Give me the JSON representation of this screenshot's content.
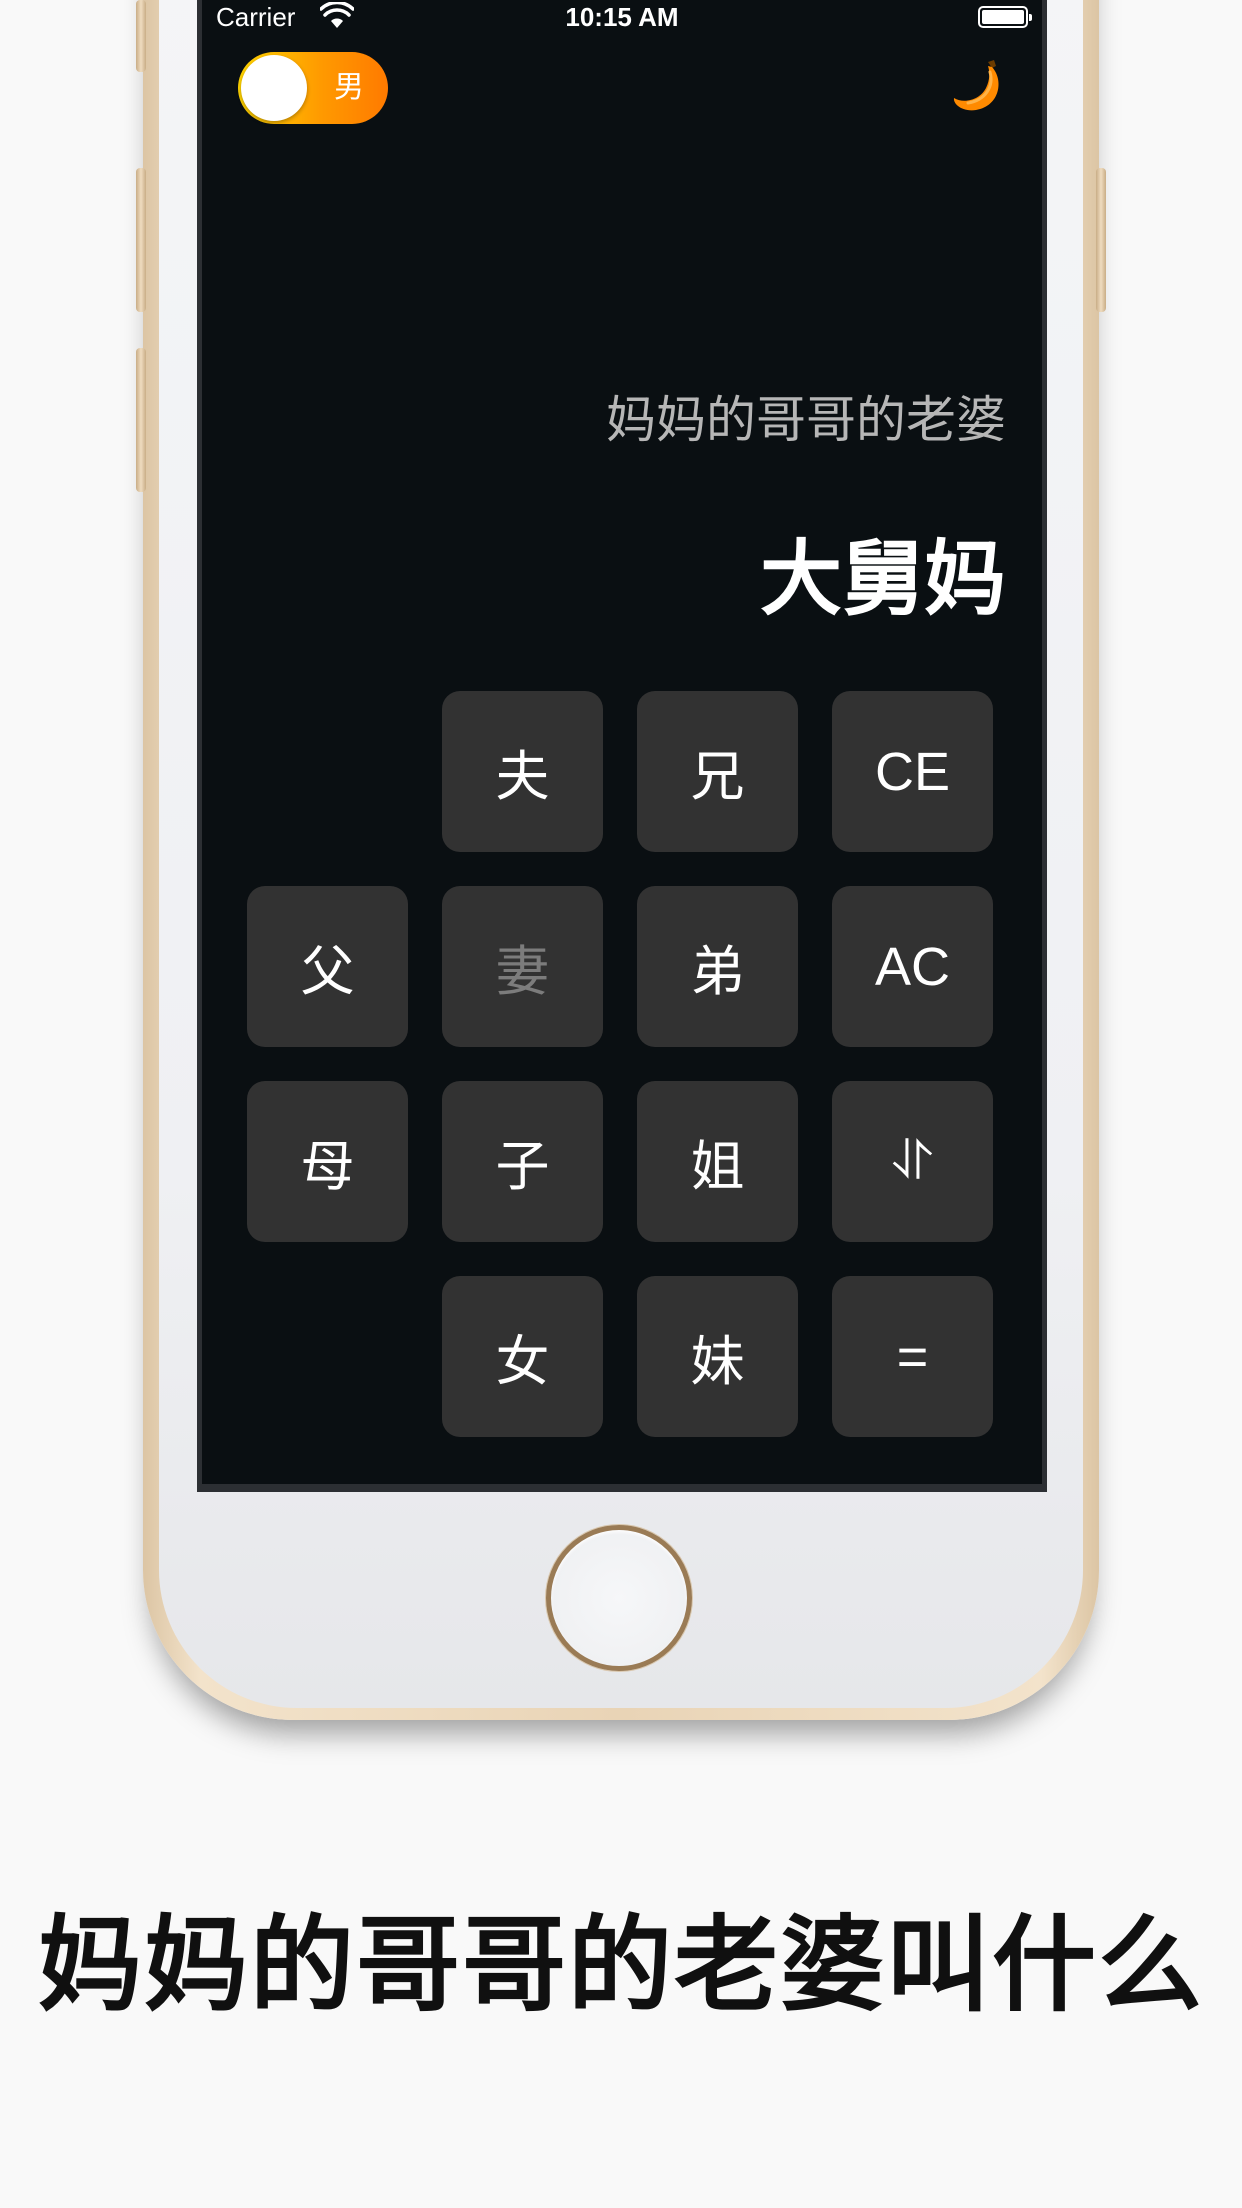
{
  "status_bar": {
    "carrier": "Carrier",
    "time": "10:15 AM"
  },
  "toggle": {
    "label": "男",
    "colors": [
      "#ffd400",
      "#ff7a00"
    ]
  },
  "icons": {
    "wifi": "wifi-icon",
    "battery": "battery-icon",
    "banana": "banana-icon"
  },
  "display": {
    "expression": "妈妈的哥哥的老婆",
    "result": "大舅妈"
  },
  "keypad": {
    "fu_husband": "夫",
    "xiong": "兄",
    "ce": "CE",
    "fu_father": "父",
    "qi": "妻",
    "di": "弟",
    "ac": "AC",
    "mu": "母",
    "zi": "子",
    "jie": "姐",
    "swap": "⥯",
    "nv": "女",
    "mei": "妹",
    "equals": "="
  },
  "caption": "妈妈的哥哥的老婆叫什么",
  "colors": {
    "screen_bg": "#0a0f12",
    "key_bg": "#323232",
    "accent": "#ff9a00",
    "page_bg": "#f9f9f9"
  }
}
